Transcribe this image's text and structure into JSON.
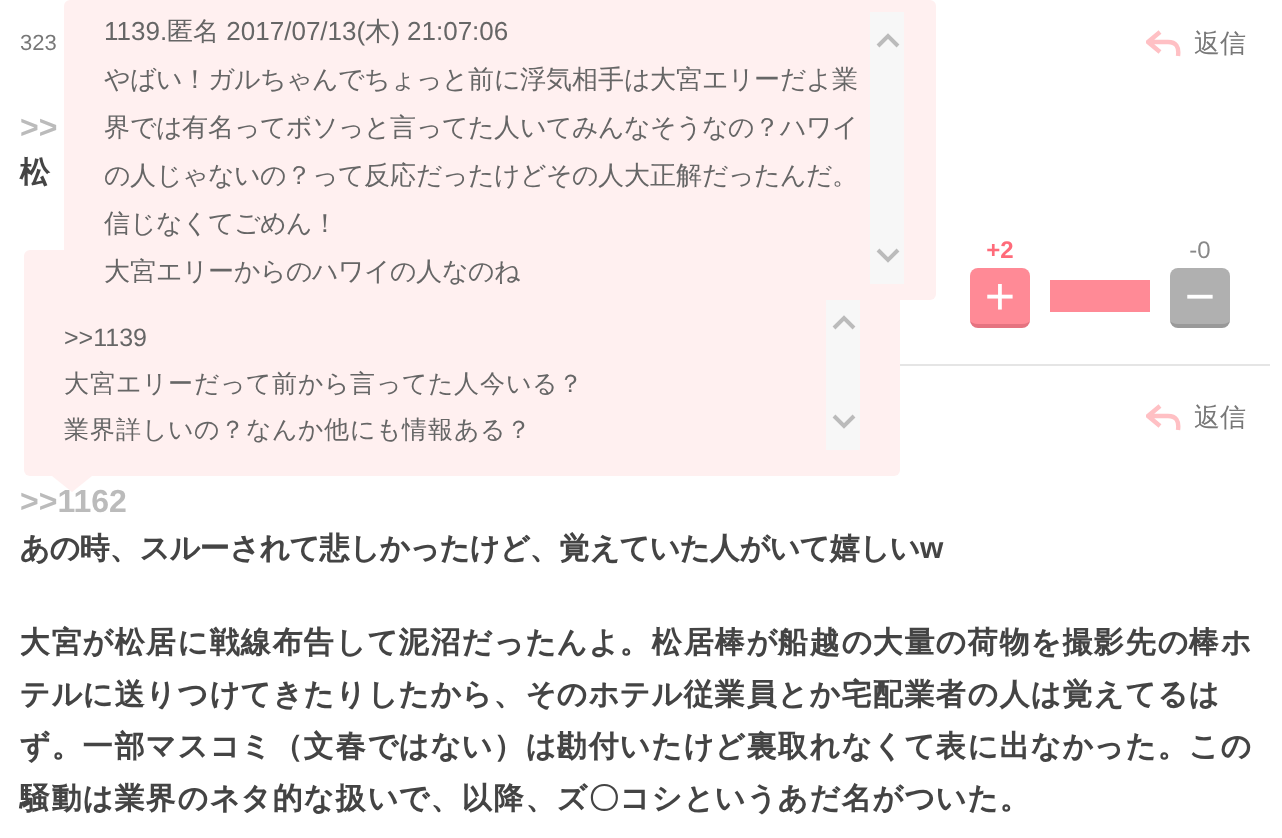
{
  "comments": [
    {
      "number": "323",
      "reply": "返信",
      "anchor": ">>",
      "body": "松",
      "votes": {
        "plus_count": "+2",
        "minus_count": "-0",
        "plus": "+",
        "minus": "−",
        "level": 1
      }
    },
    {
      "reply": "返信",
      "anchor": ">>1162",
      "lead": "あの時、スルーされて悲しかったけど、覚えていた人がいて嬉しいw",
      "body": "大宮が松居に戦線布告して泥沼だったんよ。松居棒が船越の大量の荷物を撮影先の棒ホテルに送りつけてきたりしたから、そのホテル従業員とか宅配業者の人は覚えてるはず。一部マスコミ（文春ではない）は勘付いたけど裏取れなくて表に出なかった。この騒動は業界のネタ的な扱いで、以降、ズ〇コシというあだ名がついた。"
    }
  ],
  "popups": [
    {
      "header": "1139.匿名 2017/07/13(木) 21:07:06",
      "lines": [
        "やばい！ガルちゃんでちょっと前に浮気相手は大宮エリーだよ業",
        "界では有名ってボソっと言ってた人いてみんなそうなの？ハワイ",
        "の人じゃないの？って反応だったけどその人大正解だったんだ。",
        "信じなくてごめん！",
        "大宮エリーからのハワイの人なのね"
      ]
    },
    {
      "lines": [
        ">>1139",
        "大宮エリーだって前から言ってた人今いる？",
        "業界詳しいの？なんか他にも情報ある？"
      ]
    }
  ]
}
